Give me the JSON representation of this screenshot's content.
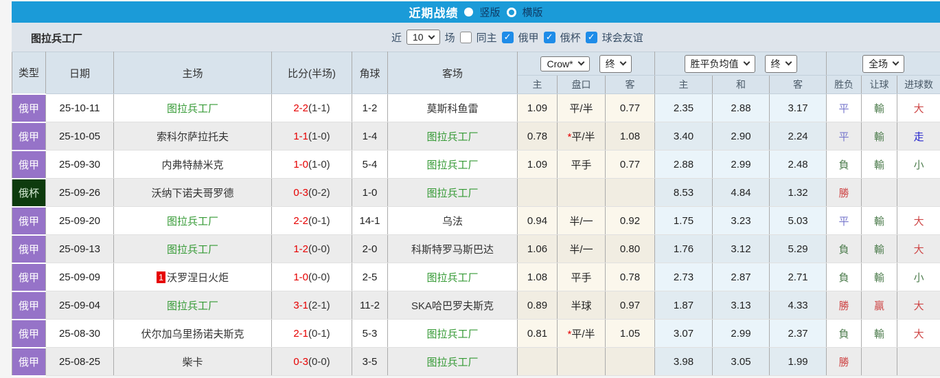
{
  "colors": {
    "topbar_blue": "#1B9BD8",
    "checkbox_blue": "#1E8CE8",
    "type_purple": "#9673C8",
    "type_dark_green": "#0E3B0E",
    "team_link_green": "#339933",
    "score_red": "#E60000",
    "result_red": "#CE4646",
    "result_green": "#4E7D4E",
    "result_soft_blue": "#7777CC",
    "result_vivid_blue": "#2222CC",
    "odds_cream_bg": "#FBF7EC",
    "avg_blue_bg": "#EAF4FA"
  },
  "titlebar": {
    "title": "近期战绩",
    "options": [
      {
        "label": "竖版",
        "selected": true
      },
      {
        "label": "横版",
        "selected": false
      }
    ]
  },
  "filterbar": {
    "team": "图拉兵工厂",
    "recent_label": "近",
    "recent_value": "10",
    "matches_label": "场",
    "checkboxes": [
      {
        "label": "同主",
        "checked": false
      },
      {
        "label": "俄甲",
        "checked": true
      },
      {
        "label": "俄杯",
        "checked": true
      },
      {
        "label": "球会友谊",
        "checked": true
      }
    ]
  },
  "table": {
    "main_headers": [
      "类型",
      "日期",
      "主场",
      "比分(半场)",
      "角球",
      "客场"
    ],
    "selects": {
      "odds_company": "Crow*",
      "odds_time": "终",
      "avg_type": "胜平负均值",
      "avg_time": "终",
      "scope": "全场"
    },
    "sub_headers": [
      "主",
      "盘口",
      "客",
      "主",
      "和",
      "客",
      "胜负",
      "让球",
      "进球数"
    ],
    "rows": [
      {
        "type": "俄甲",
        "type_class": "t-purple",
        "date": "25-10-11",
        "home": {
          "name": "图拉兵工厂",
          "green": true,
          "badge": ""
        },
        "score": "2-2",
        "half": "(1-1)",
        "corners": "1-2",
        "away": {
          "name": "莫斯科鱼雷",
          "green": false
        },
        "odds": {
          "home": "1.09",
          "handicap": "平/半",
          "star": false,
          "away": "0.77"
        },
        "avg": {
          "win": "2.35",
          "draw": "2.88",
          "lose": "3.17"
        },
        "result": {
          "text": "平",
          "color": "blue"
        },
        "handicap_result": {
          "text": "輸",
          "color": "green"
        },
        "goals": {
          "text": "大",
          "color": "red"
        }
      },
      {
        "type": "俄甲",
        "type_class": "t-purple",
        "date": "25-10-05",
        "home": {
          "name": "索科尔萨拉托夫",
          "green": false,
          "badge": ""
        },
        "score": "1-1",
        "half": "(1-0)",
        "corners": "1-4",
        "away": {
          "name": "图拉兵工厂",
          "green": true
        },
        "odds": {
          "home": "0.78",
          "handicap": "平/半",
          "star": true,
          "away": "1.08"
        },
        "avg": {
          "win": "3.40",
          "draw": "2.90",
          "lose": "2.24"
        },
        "result": {
          "text": "平",
          "color": "blue"
        },
        "handicap_result": {
          "text": "輸",
          "color": "green"
        },
        "goals": {
          "text": "走",
          "color": "vblue"
        }
      },
      {
        "type": "俄甲",
        "type_class": "t-purple",
        "date": "25-09-30",
        "home": {
          "name": "内弗特赫米克",
          "green": false,
          "badge": ""
        },
        "score": "1-0",
        "half": "(1-0)",
        "corners": "5-4",
        "away": {
          "name": "图拉兵工厂",
          "green": true
        },
        "odds": {
          "home": "1.09",
          "handicap": "平手",
          "star": false,
          "away": "0.77"
        },
        "avg": {
          "win": "2.88",
          "draw": "2.99",
          "lose": "2.48"
        },
        "result": {
          "text": "負",
          "color": "green"
        },
        "handicap_result": {
          "text": "輸",
          "color": "green"
        },
        "goals": {
          "text": "小",
          "color": "green"
        }
      },
      {
        "type": "俄杯",
        "type_class": "t-green",
        "date": "25-09-26",
        "home": {
          "name": "沃纳下诺夫哥罗德",
          "green": false,
          "badge": ""
        },
        "score": "0-3",
        "half": "(0-2)",
        "corners": "1-0",
        "away": {
          "name": "图拉兵工厂",
          "green": true
        },
        "odds": {
          "home": "",
          "handicap": "",
          "star": false,
          "away": ""
        },
        "avg": {
          "win": "8.53",
          "draw": "4.84",
          "lose": "1.32"
        },
        "result": {
          "text": "勝",
          "color": "red"
        },
        "handicap_result": {
          "text": "",
          "color": ""
        },
        "goals": {
          "text": "",
          "color": ""
        }
      },
      {
        "type": "俄甲",
        "type_class": "t-purple",
        "date": "25-09-20",
        "home": {
          "name": "图拉兵工厂",
          "green": true,
          "badge": ""
        },
        "score": "2-2",
        "half": "(0-1)",
        "corners": "14-1",
        "away": {
          "name": "乌法",
          "green": false
        },
        "odds": {
          "home": "0.94",
          "handicap": "半/一",
          "star": false,
          "away": "0.92"
        },
        "avg": {
          "win": "1.75",
          "draw": "3.23",
          "lose": "5.03"
        },
        "result": {
          "text": "平",
          "color": "blue"
        },
        "handicap_result": {
          "text": "輸",
          "color": "green"
        },
        "goals": {
          "text": "大",
          "color": "red"
        }
      },
      {
        "type": "俄甲",
        "type_class": "t-purple",
        "date": "25-09-13",
        "home": {
          "name": "图拉兵工厂",
          "green": true,
          "badge": ""
        },
        "score": "1-2",
        "half": "(0-0)",
        "corners": "2-0",
        "away": {
          "name": "科斯特罗马斯巴达",
          "green": false
        },
        "odds": {
          "home": "1.06",
          "handicap": "半/一",
          "star": false,
          "away": "0.80"
        },
        "avg": {
          "win": "1.76",
          "draw": "3.12",
          "lose": "5.29"
        },
        "result": {
          "text": "負",
          "color": "green"
        },
        "handicap_result": {
          "text": "輸",
          "color": "green"
        },
        "goals": {
          "text": "大",
          "color": "red"
        }
      },
      {
        "type": "俄甲",
        "type_class": "t-purple",
        "date": "25-09-09",
        "home": {
          "name": "沃罗涅日火炬",
          "green": false,
          "badge": "1"
        },
        "score": "1-0",
        "half": "(0-0)",
        "corners": "2-5",
        "away": {
          "name": "图拉兵工厂",
          "green": true
        },
        "odds": {
          "home": "1.08",
          "handicap": "平手",
          "star": false,
          "away": "0.78"
        },
        "avg": {
          "win": "2.73",
          "draw": "2.87",
          "lose": "2.71"
        },
        "result": {
          "text": "負",
          "color": "green"
        },
        "handicap_result": {
          "text": "輸",
          "color": "green"
        },
        "goals": {
          "text": "小",
          "color": "green"
        }
      },
      {
        "type": "俄甲",
        "type_class": "t-purple",
        "date": "25-09-04",
        "home": {
          "name": "图拉兵工厂",
          "green": true,
          "badge": ""
        },
        "score": "3-1",
        "half": "(2-1)",
        "corners": "11-2",
        "away": {
          "name": "SKA哈巴罗夫斯克",
          "green": false
        },
        "odds": {
          "home": "0.89",
          "handicap": "半球",
          "star": false,
          "away": "0.97"
        },
        "avg": {
          "win": "1.87",
          "draw": "3.13",
          "lose": "4.33"
        },
        "result": {
          "text": "勝",
          "color": "red"
        },
        "handicap_result": {
          "text": "贏",
          "color": "red"
        },
        "goals": {
          "text": "大",
          "color": "red"
        }
      },
      {
        "type": "俄甲",
        "type_class": "t-purple",
        "date": "25-08-30",
        "home": {
          "name": "伏尔加乌里扬诺夫斯克",
          "green": false,
          "badge": ""
        },
        "score": "2-1",
        "half": "(0-1)",
        "corners": "5-3",
        "away": {
          "name": "图拉兵工厂",
          "green": true
        },
        "odds": {
          "home": "0.81",
          "handicap": "平/半",
          "star": true,
          "away": "1.05"
        },
        "avg": {
          "win": "3.07",
          "draw": "2.99",
          "lose": "2.37"
        },
        "result": {
          "text": "負",
          "color": "green"
        },
        "handicap_result": {
          "text": "輸",
          "color": "green"
        },
        "goals": {
          "text": "大",
          "color": "red"
        }
      },
      {
        "type": "俄甲",
        "type_class": "t-purple",
        "date": "25-08-25",
        "home": {
          "name": "柴卡",
          "green": false,
          "badge": ""
        },
        "score": "0-3",
        "half": "(0-0)",
        "corners": "3-5",
        "away": {
          "name": "图拉兵工厂",
          "green": true
        },
        "odds": {
          "home": "",
          "handicap": "",
          "star": false,
          "away": ""
        },
        "avg": {
          "win": "3.98",
          "draw": "3.05",
          "lose": "1.99"
        },
        "result": {
          "text": "勝",
          "color": "red"
        },
        "handicap_result": {
          "text": "",
          "color": ""
        },
        "goals": {
          "text": "",
          "color": ""
        }
      }
    ]
  }
}
